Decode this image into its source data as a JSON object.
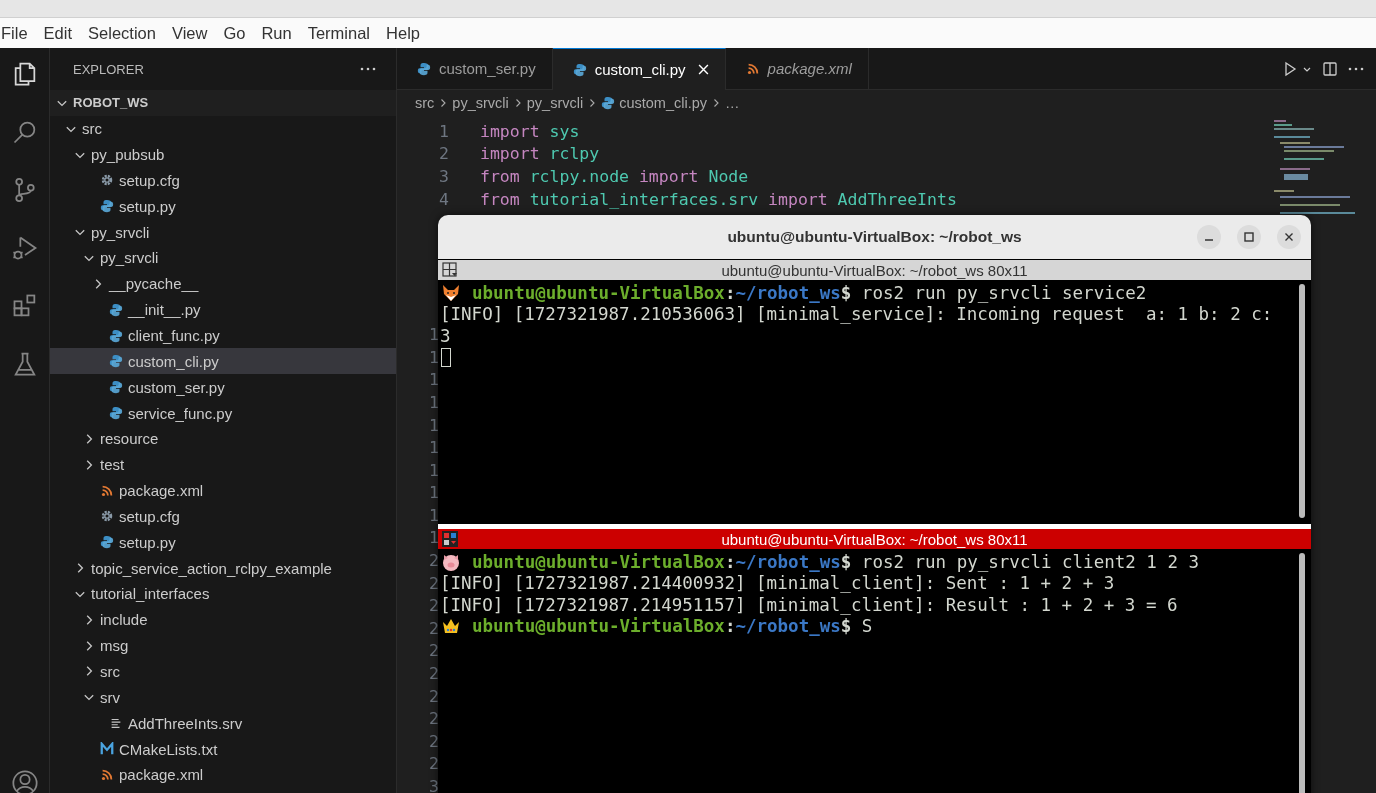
{
  "menu": [
    "File",
    "Edit",
    "Selection",
    "View",
    "Go",
    "Run",
    "Terminal",
    "Help"
  ],
  "activity_bar": [
    {
      "kind": "explorer",
      "selected": true
    },
    {
      "kind": "search",
      "selected": false
    },
    {
      "kind": "source-control",
      "selected": false
    },
    {
      "kind": "run-debug",
      "selected": false
    },
    {
      "kind": "extensions",
      "selected": false
    },
    {
      "kind": "testing",
      "selected": false
    }
  ],
  "explorer": {
    "title": "EXPLORER",
    "tree": [
      {
        "label": "ROBOT_WS",
        "kind": "root",
        "expanded": true,
        "children": [
          {
            "label": "src",
            "kind": "folder",
            "expanded": true,
            "children": [
              {
                "label": "py_pubsub",
                "kind": "folder",
                "expanded": true,
                "children": [
                  {
                    "label": "setup.cfg",
                    "kind": "config"
                  },
                  {
                    "label": "setup.py",
                    "kind": "python"
                  }
                ]
              },
              {
                "label": "py_srvcli",
                "kind": "folder",
                "expanded": true,
                "children": [
                  {
                    "label": "py_srvcli",
                    "kind": "folder",
                    "expanded": true,
                    "children": [
                      {
                        "label": "__pycache__",
                        "kind": "folder",
                        "expanded": false
                      },
                      {
                        "label": "__init__.py",
                        "kind": "python",
                        "selected": false
                      },
                      {
                        "label": "client_func.py",
                        "kind": "python",
                        "selected": false
                      },
                      {
                        "label": "custom_cli.py",
                        "kind": "python",
                        "selected": true
                      },
                      {
                        "label": "custom_ser.py",
                        "kind": "python",
                        "selected": false
                      },
                      {
                        "label": "service_func.py",
                        "kind": "python",
                        "selected": false
                      }
                    ]
                  },
                  {
                    "label": "resource",
                    "kind": "folder",
                    "expanded": false
                  },
                  {
                    "label": "test",
                    "kind": "folder",
                    "expanded": false
                  },
                  {
                    "label": "package.xml",
                    "kind": "xml"
                  },
                  {
                    "label": "setup.cfg",
                    "kind": "config"
                  },
                  {
                    "label": "setup.py",
                    "kind": "python"
                  }
                ]
              },
              {
                "label": "topic_service_action_rclpy_example",
                "kind": "folder",
                "expanded": false
              },
              {
                "label": "tutorial_interfaces",
                "kind": "folder",
                "expanded": true,
                "children": [
                  {
                    "label": "include",
                    "kind": "folder",
                    "expanded": false
                  },
                  {
                    "label": "msg",
                    "kind": "folder",
                    "expanded": false
                  },
                  {
                    "label": "src",
                    "kind": "folder",
                    "expanded": false
                  },
                  {
                    "label": "srv",
                    "kind": "folder",
                    "expanded": true,
                    "children": [
                      {
                        "label": "AddThreeInts.srv",
                        "kind": "text"
                      }
                    ]
                  },
                  {
                    "label": "CMakeLists.txt",
                    "kind": "cmake"
                  },
                  {
                    "label": "package.xml",
                    "kind": "xml"
                  }
                ]
              }
            ]
          }
        ]
      }
    ]
  },
  "tabs": [
    {
      "label": "custom_ser.py",
      "kind": "python",
      "selected": false,
      "preview": false
    },
    {
      "label": "custom_cli.py",
      "kind": "python",
      "selected": true,
      "preview": false
    },
    {
      "label": "package.xml",
      "kind": "xml",
      "selected": false,
      "preview": true
    }
  ],
  "breadcrumb": [
    {
      "label": "src"
    },
    {
      "label": "py_srvcli"
    },
    {
      "label": "py_srvcli"
    },
    {
      "label": "custom_cli.py",
      "kind": "python"
    },
    {
      "label": "…"
    }
  ],
  "editor": {
    "lines": [
      {
        "number": "1",
        "tokens": [
          {
            "text": "import",
            "kind": "keyword"
          },
          {
            "text": "sys",
            "kind": "module"
          }
        ]
      },
      {
        "number": "2",
        "tokens": [
          {
            "text": "import",
            "kind": "keyword"
          },
          {
            "text": "rclpy",
            "kind": "module"
          }
        ]
      },
      {
        "number": "3",
        "tokens": [
          {
            "text": "from",
            "kind": "keyword"
          },
          {
            "text": "rclpy.node",
            "kind": "module"
          },
          {
            "text": "import",
            "kind": "keyword"
          },
          {
            "text": "Node",
            "kind": "module"
          }
        ]
      },
      {
        "number": "4",
        "tokens": [
          {
            "text": "from",
            "kind": "keyword"
          },
          {
            "text": "tutorial_interfaces.srv",
            "kind": "module"
          },
          {
            "text": "import",
            "kind": "keyword"
          },
          {
            "text": "AddThreeInts",
            "kind": "module"
          }
        ]
      }
    ],
    "covered_gutter": [
      "1",
      "1",
      "1",
      "1",
      "1",
      "1",
      "1",
      "1",
      "1",
      "1",
      "2",
      "2",
      "2",
      "2",
      "2",
      "2",
      "2",
      "2",
      "2",
      "2",
      "3"
    ]
  },
  "terminal": {
    "title": "ubuntu@ubuntu-VirtualBox: ~/robot_ws",
    "panes": [
      {
        "header": "ubuntu@ubuntu-VirtualBox: ~/robot_ws 80x11",
        "active": false,
        "lines": [
          {
            "kind": "prompt",
            "user": "ubuntu@ubuntu-VirtualBox",
            "separator": ":",
            "path": "~/robot_ws",
            "sigil": "$",
            "command": "ros2 run py_srvcli service2"
          },
          {
            "kind": "output",
            "text": "[INFO] [1727321987.210536063] [minimal_service]: Incoming request  a: 1 b: 2 c:"
          },
          {
            "kind": "output",
            "text": "3"
          },
          {
            "kind": "cursor"
          }
        ]
      },
      {
        "header": "ubuntu@ubuntu-VirtualBox: ~/robot_ws 80x11",
        "active": true,
        "lines": [
          {
            "kind": "prompt",
            "user": "ubuntu@ubuntu-VirtualBox",
            "separator": ":",
            "path": "~/robot_ws",
            "sigil": "$",
            "command": "ros2 run py_srvcli client2 1 2 3"
          },
          {
            "kind": "output",
            "text": "[INFO] [1727321987.214400932] [minimal_client]: Sent : 1 + 2 + 3"
          },
          {
            "kind": "output",
            "text": "[INFO] [1727321987.214951157] [minimal_client]: Result : 1 + 2 + 3 = 6"
          },
          {
            "kind": "prompt",
            "user": "ubuntu@ubuntu-VirtualBox",
            "separator": ":",
            "path": "~/robot_ws",
            "sigil": "$",
            "command": "S"
          }
        ]
      }
    ]
  }
}
